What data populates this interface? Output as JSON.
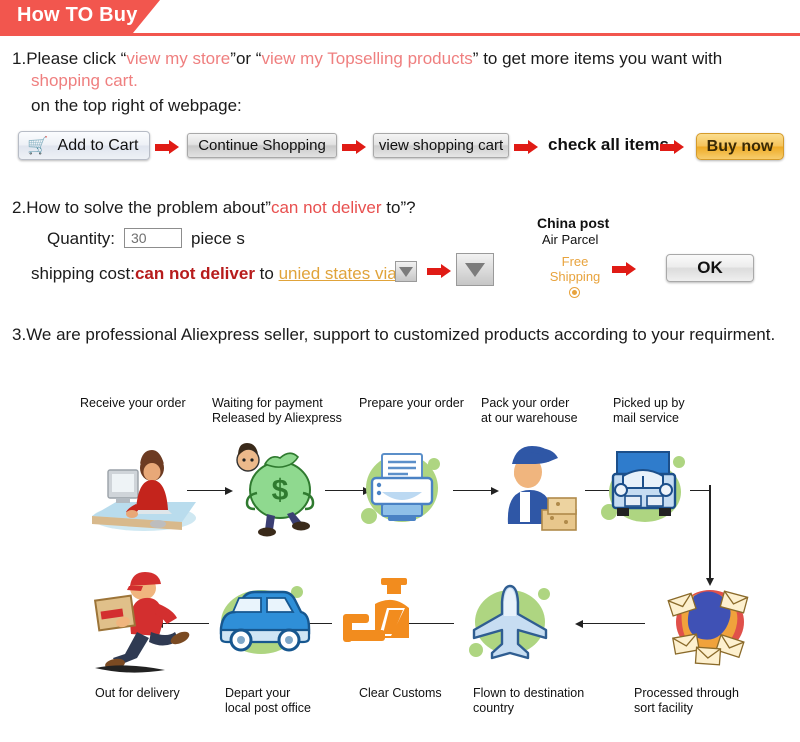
{
  "header": {
    "title": "How TO Buy",
    "accent_color": "#f2564e"
  },
  "steps": {
    "step1": {
      "number": "1.",
      "text_a": "Please click ",
      "quote_open": "“",
      "link1": "view my store",
      "quote_close": "”",
      "text_b": "or ",
      "link2": "view my Topselling products",
      "text_c": " to get more items you want with",
      "link3": "shopping cart.",
      "text_d": "on the top right of webpage:"
    },
    "step2": {
      "number": "2.",
      "text_a": "How to solve the problem about",
      "quote_open": "”",
      "warning": "can not deliver",
      "text_b": " to",
      "quote_close": "”?",
      "quantity_label": "Quantity:",
      "quantity_value": "30",
      "piece_label": "piece s",
      "shipping_label": "shipping cost:",
      "shipping_warning": "can not deliver",
      "shipping_to": " to ",
      "country_select": "unied states via"
    },
    "step3": {
      "number": "3.",
      "text": "We are professional Aliexpress seller, support to customized products according to your requirment."
    }
  },
  "buttons": {
    "add_to_cart": "Add to Cart",
    "cart_icon": "shopping-cart-icon",
    "continue_shopping": "Continue Shopping",
    "view_shopping_cart": "view shopping cart",
    "check_all_items": "check all items",
    "buy_now": "Buy now",
    "ok": "OK"
  },
  "shipping_panel": {
    "carrier": "China post",
    "service": "Air Parcel",
    "free_line1": "Free",
    "free_line2": "Shipping",
    "radio_icon": "radio-selected-icon"
  },
  "flow": {
    "top_row": [
      {
        "label": "Receive your order",
        "icon": "person-at-computer-icon"
      },
      {
        "label": "Waiting for payment\nReleased by Aliexpress",
        "icon": "money-bag-icon"
      },
      {
        "label": "Prepare your order",
        "icon": "printer-icon"
      },
      {
        "label": "Pack your order\nat our warehouse",
        "icon": "worker-packing-boxes-icon"
      },
      {
        "label": "Picked up by\nmail service",
        "icon": "mail-truck-icon"
      }
    ],
    "bottom_row": [
      {
        "label": "Out for delivery",
        "icon": "running-courier-icon"
      },
      {
        "label": "Depart your\nlocal post office",
        "icon": "delivery-van-icon"
      },
      {
        "label": "Clear Customs",
        "icon": "customs-officer-icon"
      },
      {
        "label": "Flown to destination\ncountry",
        "icon": "airplane-icon"
      },
      {
        "label": "Processed through\nsort facility",
        "icon": "mail-sorting-icon"
      }
    ]
  }
}
